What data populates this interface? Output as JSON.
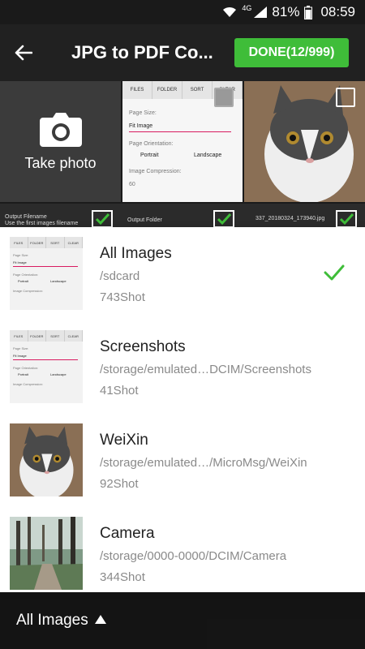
{
  "status": {
    "network": "4G",
    "battery": "81%",
    "time": "08:59"
  },
  "toolbar": {
    "title": "JPG to PDF Co...",
    "done_label": "DONE(12/999)"
  },
  "grid": {
    "take_photo_label": "Take photo",
    "settings_preview": {
      "tabs": [
        "FILES",
        "FOLDER",
        "SORT",
        "CLEAR"
      ],
      "page_size_label": "Page Size:",
      "page_size_value": "Fit Image",
      "orientation_label": "Page Orientation:",
      "portrait": "Portrait",
      "landscape": "Landscape",
      "compression_label": "Image Compression:",
      "compression_value": "60"
    },
    "row2_labels": [
      "Output Filename",
      "Use the first images filename",
      "Output Folder",
      "337_20180324_173940.jpg"
    ]
  },
  "folders": [
    {
      "name": "All Images",
      "path": "/sdcard",
      "count": "743Shot",
      "selected": true,
      "thumb": "settings-screenshot"
    },
    {
      "name": "Screenshots",
      "path": "/storage/emulated…DCIM/Screenshots",
      "count": "41Shot",
      "selected": false,
      "thumb": "settings-screenshot"
    },
    {
      "name": "WeiXin",
      "path": "/storage/emulated…/MicroMsg/WeiXin",
      "count": "92Shot",
      "selected": false,
      "thumb": "cat-photo"
    },
    {
      "name": "Camera",
      "path": "/storage/0000-0000/DCIM/Camera",
      "count": "344Shot",
      "selected": false,
      "thumb": "forest-photo"
    }
  ],
  "bottom": {
    "label": "All Images"
  },
  "colors": {
    "accent": "#3fbd39",
    "toolbar": "#212121"
  }
}
